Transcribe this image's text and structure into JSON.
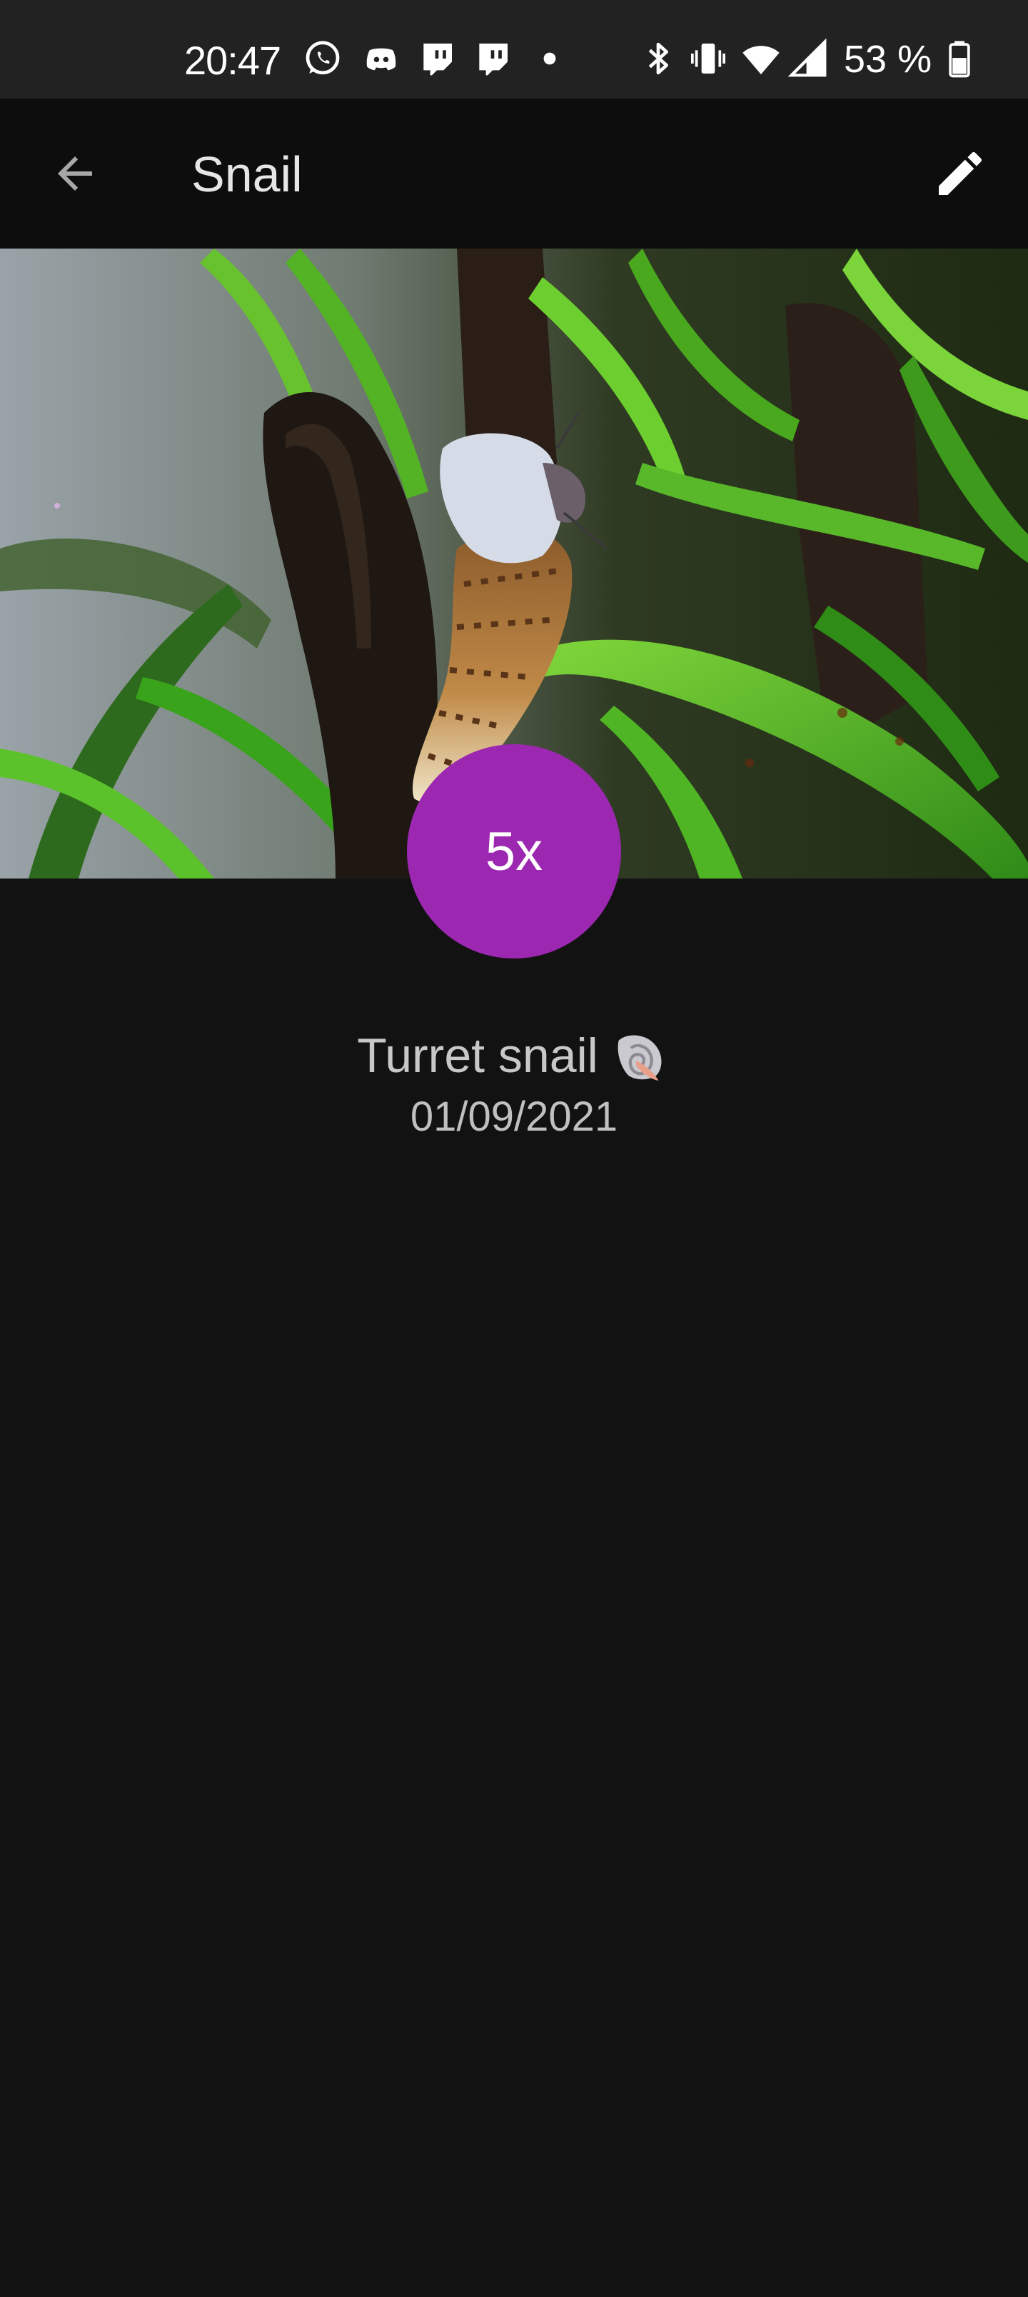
{
  "status_bar": {
    "time": "20:47",
    "battery_text": "53 %",
    "notification_icons": [
      "whatsapp-icon",
      "discord-icon",
      "twitch-icon",
      "twitch-icon",
      "dot-icon"
    ],
    "system_icons": [
      "bluetooth-icon",
      "vibrate-icon",
      "wifi-icon",
      "cell-signal-icon",
      "battery-icon"
    ]
  },
  "app_bar": {
    "back_icon": "arrow-left-icon",
    "title": "Snail",
    "edit_icon": "pencil-icon"
  },
  "item": {
    "count_label": "5x",
    "name": "Turret snail",
    "emoji_icon": "spiral-shell-icon",
    "date": "01/09/2021"
  },
  "colors": {
    "badge": "#9c27b0",
    "background": "#121212",
    "app_bar": "#0d0d0d",
    "status_bar": "#222222"
  }
}
